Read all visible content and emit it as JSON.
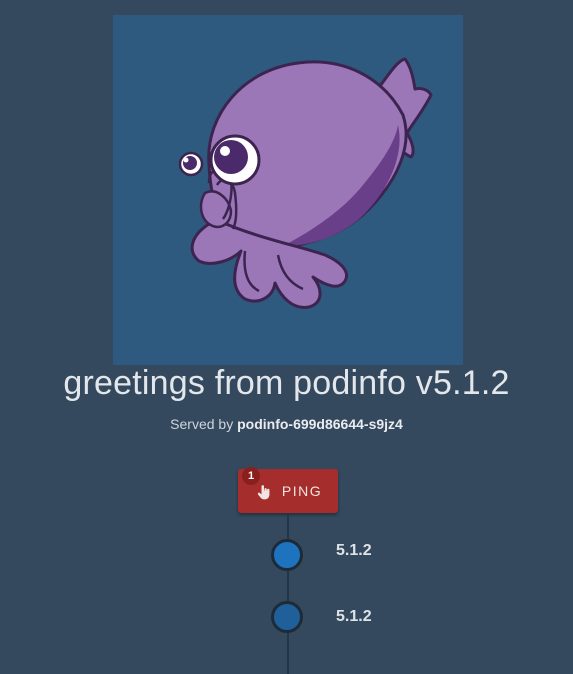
{
  "header": {
    "title": "greetings from podinfo v5.1.2"
  },
  "server": {
    "prefix": "Served by",
    "hostname": "podinfo-699d86644-s9jz4"
  },
  "ping": {
    "label": "PING",
    "count": "1",
    "icon": "touch-app-icon"
  },
  "timeline": {
    "items": [
      {
        "version": "5.1.2",
        "color": "#1e73be"
      },
      {
        "version": "5.1.2",
        "color": "#1f5f9a"
      }
    ]
  },
  "colors": {
    "background": "#34495e",
    "hero_background": "#2f5a7f",
    "mascot": "#9b77b8",
    "button": "#a52d2b"
  }
}
